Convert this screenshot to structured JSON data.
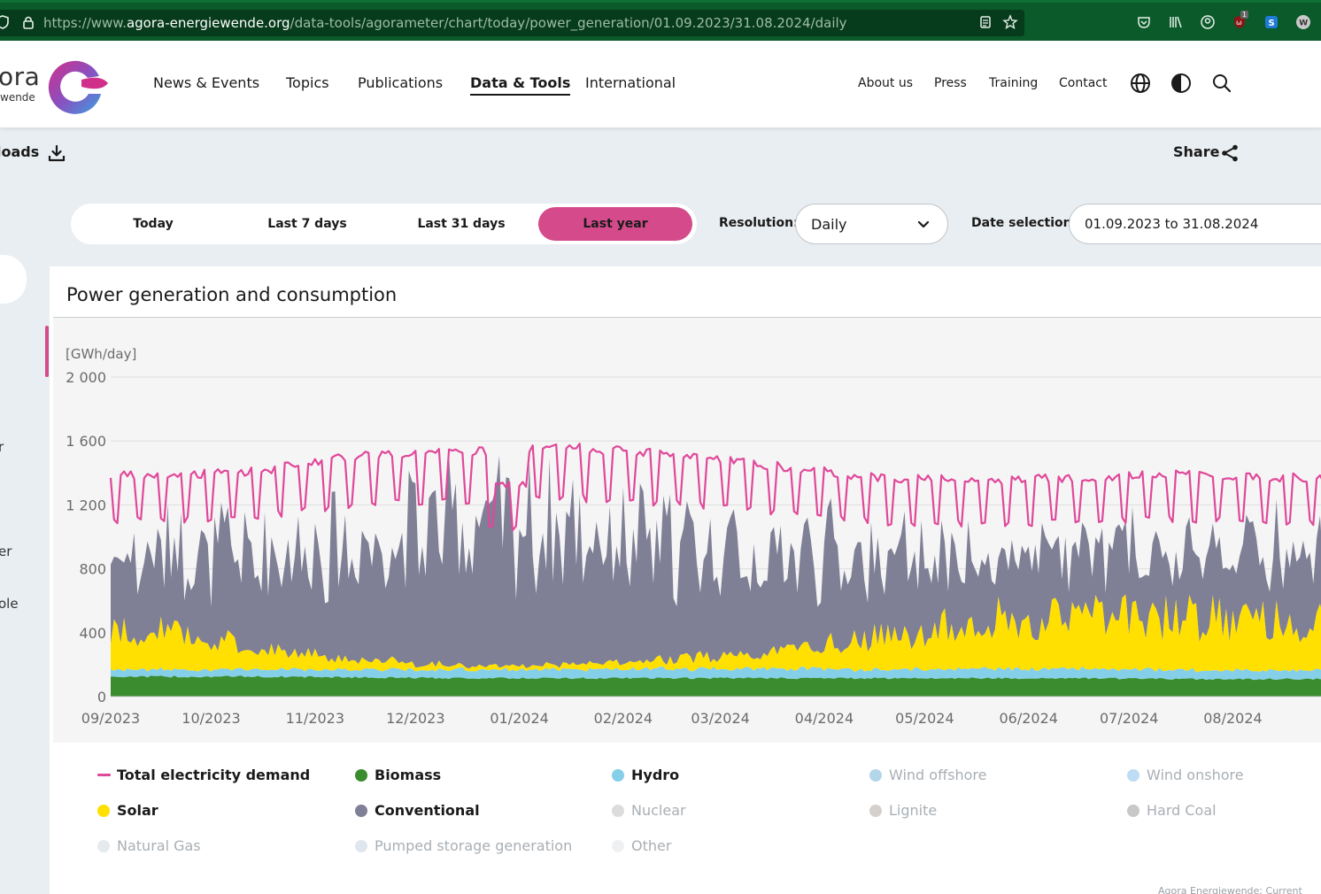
{
  "browser": {
    "url_scheme": "https://www.",
    "url_host": "agora-energiewende.org",
    "url_path": "/data-tools/agorameter/chart/today/power_generation/01.09.2023/31.08.2024/daily",
    "extension_badge": "1"
  },
  "header": {
    "logo_text": "ora",
    "logo_sub": "wende",
    "nav": [
      "News & Events",
      "Topics",
      "Publications",
      "Data & Tools",
      "International"
    ],
    "nav_active": "Data & Tools",
    "secondary_nav": [
      "About us",
      "Press",
      "Training",
      "Contact"
    ]
  },
  "toolbar": {
    "downloads_label": "loads",
    "share_label": "Share"
  },
  "controls": {
    "ranges": [
      "Today",
      "Last 7 days",
      "Last 31 days",
      "Last year"
    ],
    "active_range": "Last year",
    "resolution_label": "Resolution:",
    "resolution_value": "Daily",
    "date_label": "Date selection:",
    "date_value": "01.09.2023 to 31.08.2024"
  },
  "left_fragments": [
    "r",
    "er",
    "ole"
  ],
  "card": {
    "title": "Power generation and consumption",
    "source_text": "Agora Energiewende; Current"
  },
  "colors": {
    "accent": "#d44a8b",
    "demand": "#e0489a",
    "biomass": "#3a8c2e",
    "hydro": "#85cfe8",
    "solar": "#ffe000",
    "conventional": "#7f7f96"
  },
  "chart_data": {
    "type": "area",
    "title": "Power generation and consumption",
    "ylabel": "[GWh/day]",
    "ylim": [
      0,
      2000
    ],
    "yticks": [
      0,
      400,
      800,
      1200,
      1600,
      2000
    ],
    "ytick_labels": [
      "0",
      "400",
      "800",
      "1 200",
      "1 600",
      "2 000"
    ],
    "xticks": [
      "09/2023",
      "10/2023",
      "11/2023",
      "12/2023",
      "01/2024",
      "02/2024",
      "03/2024",
      "04/2024",
      "05/2024",
      "06/2024",
      "07/2024",
      "08/2024"
    ],
    "x_range": [
      "2023-09-01",
      "2024-08-31"
    ],
    "grid": true,
    "resolution": "daily",
    "monthly_average_gwh_day": {
      "months": [
        "09/2023",
        "10/2023",
        "11/2023",
        "12/2023",
        "01/2024",
        "02/2024",
        "03/2024",
        "04/2024",
        "05/2024",
        "06/2024",
        "07/2024",
        "08/2024"
      ],
      "biomass": [
        125,
        125,
        120,
        115,
        115,
        115,
        115,
        115,
        115,
        115,
        110,
        110
      ],
      "hydro": [
        45,
        45,
        50,
        55,
        55,
        60,
        60,
        55,
        60,
        60,
        55,
        55
      ],
      "solar": [
        240,
        130,
        60,
        25,
        30,
        60,
        110,
        200,
        300,
        330,
        340,
        300
      ],
      "conventional": [
        500,
        600,
        750,
        900,
        850,
        700,
        620,
        520,
        400,
        400,
        420,
        430
      ],
      "total_demand": [
        1330,
        1360,
        1460,
        1470,
        1500,
        1460,
        1390,
        1320,
        1300,
        1320,
        1340,
        1320
      ]
    },
    "series": [
      {
        "name": "Total electricity demand",
        "kind": "line",
        "visible": true,
        "color": "#e0489a"
      },
      {
        "name": "Biomass",
        "kind": "area",
        "visible": true,
        "color": "#3a8c2e"
      },
      {
        "name": "Hydro",
        "kind": "area",
        "visible": true,
        "color": "#85cfe8"
      },
      {
        "name": "Wind offshore",
        "kind": "area",
        "visible": false,
        "color": "#9cc7e3"
      },
      {
        "name": "Wind onshore",
        "kind": "area",
        "visible": false,
        "color": "#a8d0ef"
      },
      {
        "name": "Solar",
        "kind": "area",
        "visible": true,
        "color": "#ffe000"
      },
      {
        "name": "Conventional",
        "kind": "area",
        "visible": true,
        "color": "#7f7f96"
      },
      {
        "name": "Nuclear",
        "kind": "area",
        "visible": false,
        "color": "#d0d0d0"
      },
      {
        "name": "Lignite",
        "kind": "area",
        "visible": false,
        "color": "#c8c0bb"
      },
      {
        "name": "Hard Coal",
        "kind": "area",
        "visible": false,
        "color": "#b5b5b5"
      },
      {
        "name": "Natural Gas",
        "kind": "area",
        "visible": false,
        "color": "#dce3ea"
      },
      {
        "name": "Pumped storage generation",
        "kind": "area",
        "visible": false,
        "color": "#d6dde8"
      },
      {
        "name": "Other",
        "kind": "area",
        "visible": false,
        "color": "#e8ebee"
      }
    ]
  }
}
